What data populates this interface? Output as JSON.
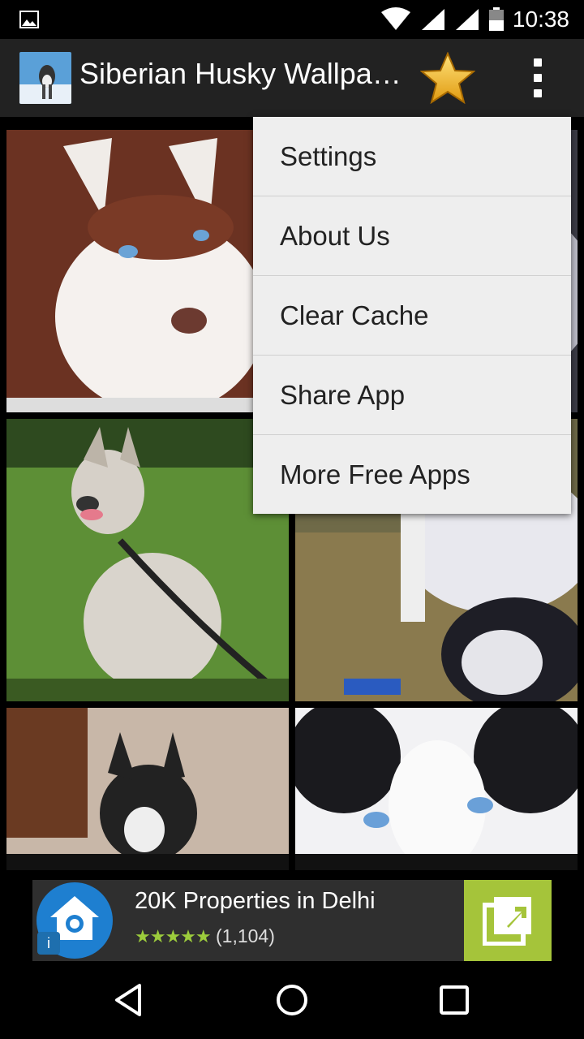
{
  "status_bar": {
    "time": "10:38",
    "icons": [
      "image-icon",
      "wifi-icon",
      "signal-icon",
      "signal-icon",
      "battery-icon"
    ]
  },
  "action_bar": {
    "title": "Siberian Husky Wallpa…",
    "icons": [
      "app-icon",
      "star-icon",
      "overflow-menu-icon"
    ]
  },
  "overflow_menu": {
    "items": [
      {
        "label": "Settings"
      },
      {
        "label": "About Us"
      },
      {
        "label": "Clear Cache"
      },
      {
        "label": "Share App"
      },
      {
        "label": "More Free Apps"
      }
    ]
  },
  "gallery": {
    "tiles": [
      {
        "name": "husky-puppy-brown"
      },
      {
        "name": "husky-puppy-grey"
      },
      {
        "name": "husky-sitting-grass"
      },
      {
        "name": "husky-with-puppy"
      },
      {
        "name": "husky-puppy-black"
      },
      {
        "name": "husky-eyes-closeup"
      }
    ]
  },
  "ad": {
    "title": "20K Properties in Delhi",
    "rating_stars": "★★★★★",
    "rating_count": "(1,104)",
    "info_label": "i",
    "accent": "#a5c43a"
  },
  "nav_bar": {
    "buttons": [
      "back-icon",
      "home-icon",
      "recents-icon"
    ]
  },
  "colors": {
    "action_bar": "#222222",
    "menu_bg": "#eeeeee",
    "status_bar": "#000000"
  }
}
